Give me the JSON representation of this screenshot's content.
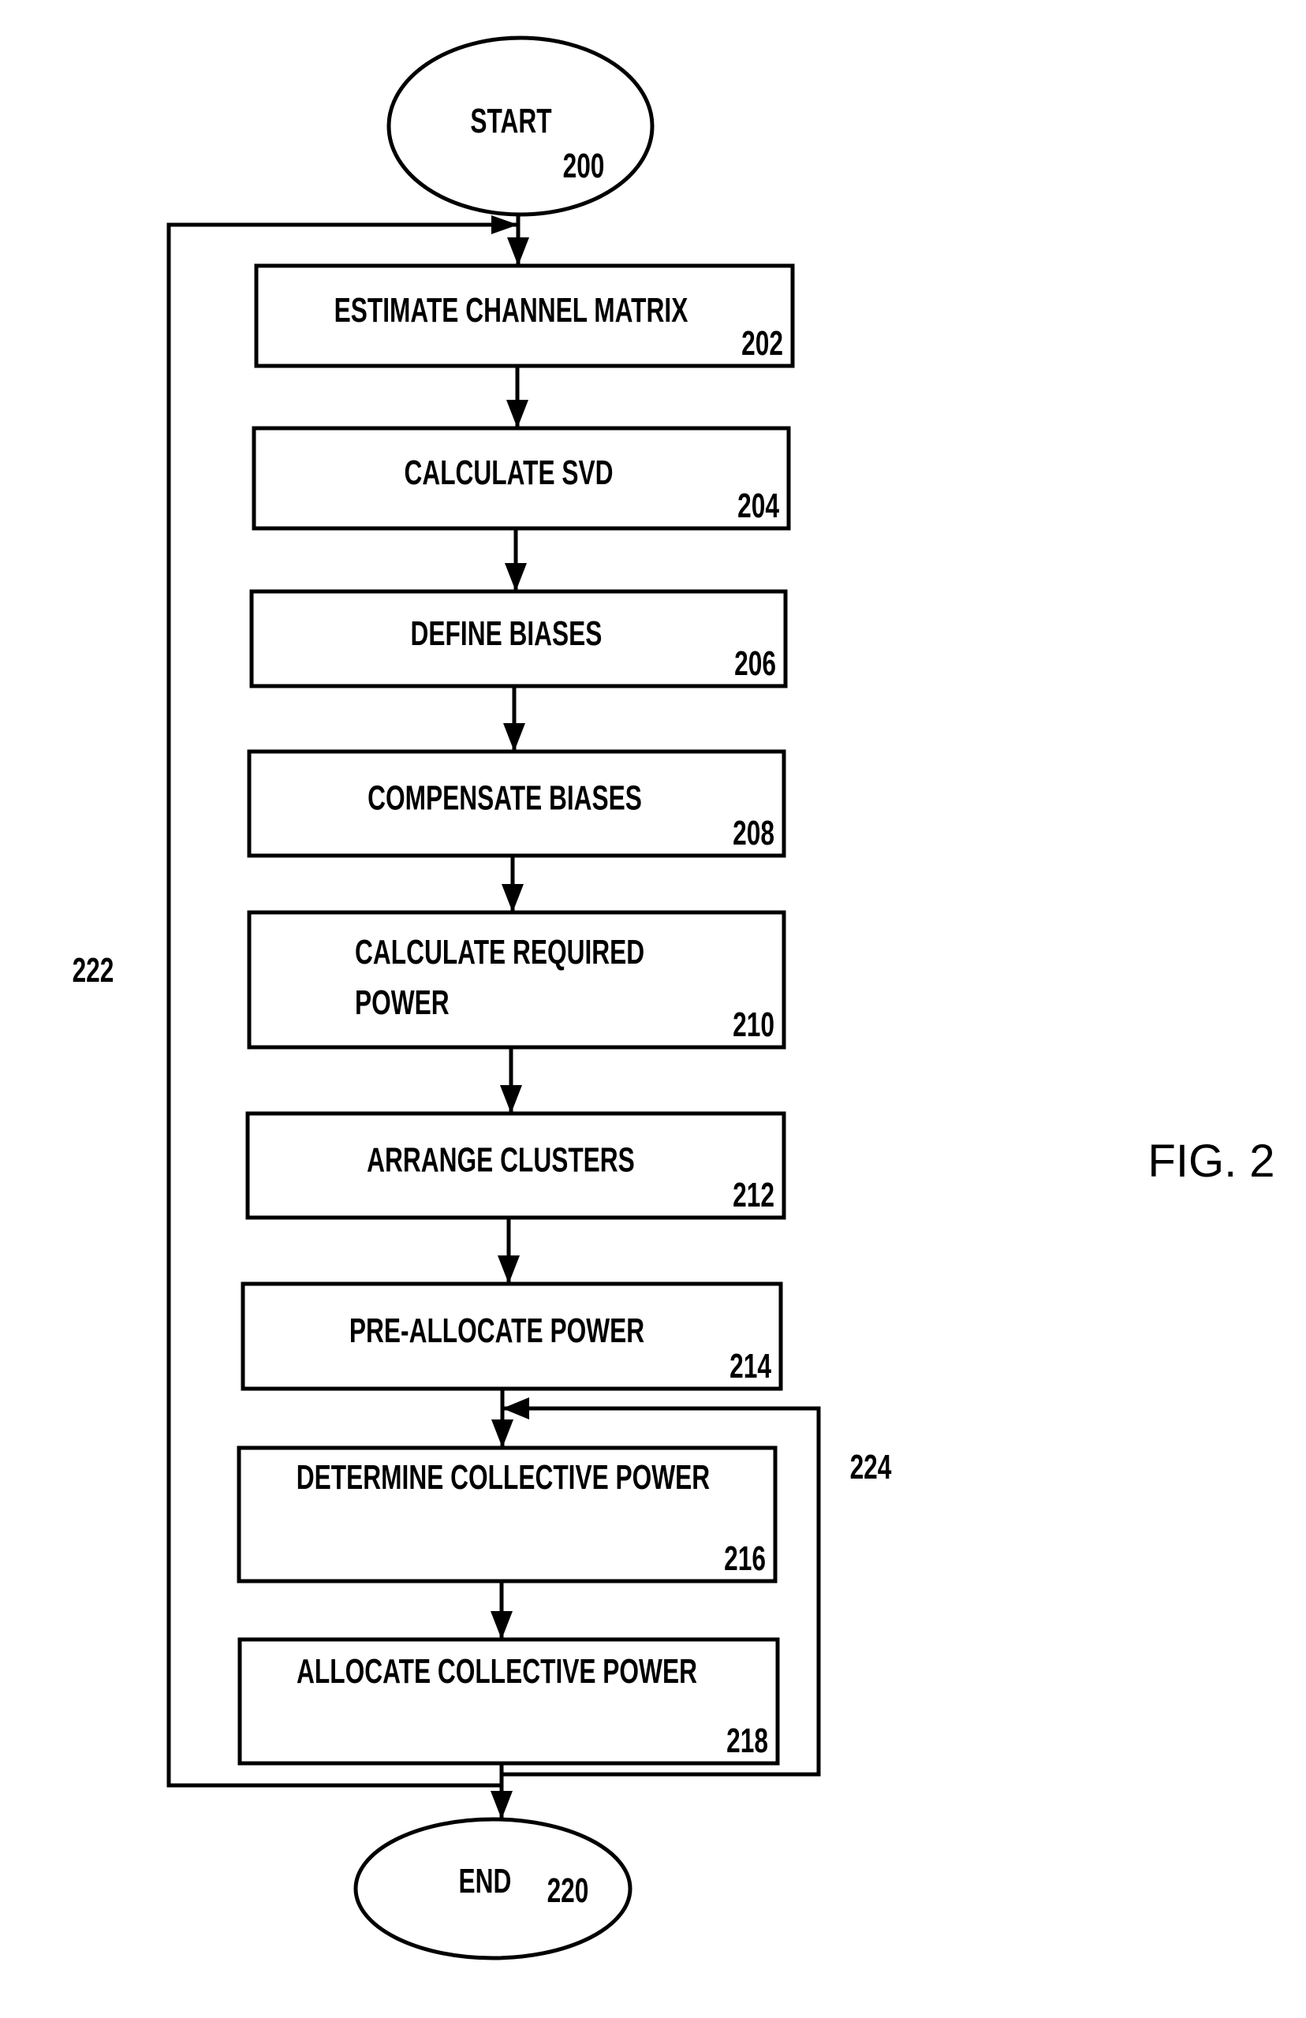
{
  "figure": {
    "label": "FIG. 2",
    "start": {
      "text": "START",
      "ref": "200"
    },
    "end": {
      "text": "END",
      "ref": "220"
    },
    "steps": [
      {
        "lines": [
          "ESTIMATE CHANNEL MATRIX"
        ],
        "ref": "202"
      },
      {
        "lines": [
          "CALCULATE SVD"
        ],
        "ref": "204"
      },
      {
        "lines": [
          "DEFINE BIASES"
        ],
        "ref": "206"
      },
      {
        "lines": [
          "COMPENSATE BIASES"
        ],
        "ref": "208"
      },
      {
        "lines": [
          "CALCULATE REQUIRED",
          "POWER"
        ],
        "ref": "210"
      },
      {
        "lines": [
          "ARRANGE CLUSTERS"
        ],
        "ref": "212"
      },
      {
        "lines": [
          "PRE-ALLOCATE POWER"
        ],
        "ref": "214"
      },
      {
        "lines": [
          "DETERMINE COLLECTIVE  POWER"
        ],
        "ref": "216"
      },
      {
        "lines": [
          "ALLOCATE COLLECTIVE POWER"
        ],
        "ref": "218"
      }
    ],
    "loops": [
      {
        "ref": "222",
        "from": "218",
        "to": "202"
      },
      {
        "ref": "224",
        "from": "218",
        "to": "216"
      }
    ]
  }
}
